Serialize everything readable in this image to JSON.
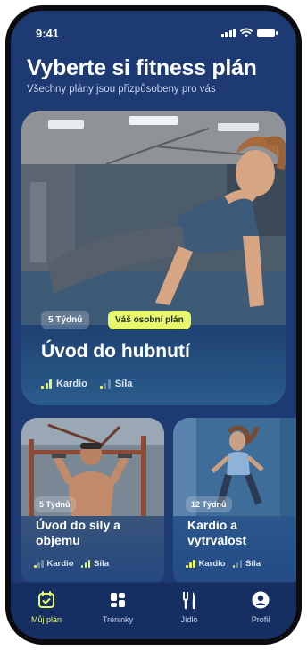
{
  "status_bar": {
    "time": "9:41"
  },
  "header": {
    "title": "Vyberte si fitness plán",
    "subtitle": "Všechny plány jsou přizpůsobeny pro vás"
  },
  "featured_plan": {
    "duration": "5 Týdnů",
    "badge": "Váš osobní plán",
    "name": "Úvod do hubnutí",
    "tags": [
      {
        "label": "Kardio",
        "level": 3,
        "max_level": 3
      },
      {
        "label": "Síla",
        "level": 1,
        "max_level": 3
      }
    ]
  },
  "plans": [
    {
      "duration": "5 Týdnů",
      "name_line1": "Úvod do síly a",
      "name_line2": "objemu",
      "tags": [
        {
          "label": "Kardio",
          "level": 1,
          "max_level": 3
        },
        {
          "label": "Síla",
          "level": 3,
          "max_level": 3
        }
      ]
    },
    {
      "duration": "12 Týdnů",
      "name_line1": "Kardio a",
      "name_line2": "vytrvalost",
      "tags": [
        {
          "label": "Kardio",
          "level": 3,
          "max_level": 3
        },
        {
          "label": "Síla",
          "level": 1,
          "max_level": 3
        }
      ]
    }
  ],
  "tab_bar": {
    "items": [
      {
        "label": "Můj plán",
        "icon": "calendar-check-icon",
        "active": true
      },
      {
        "label": "Tréninky",
        "icon": "grid-icon",
        "active": false
      },
      {
        "label": "Jídlo",
        "icon": "cutlery-icon",
        "active": false
      },
      {
        "label": "Profil",
        "icon": "profile-icon",
        "active": false
      }
    ]
  },
  "colors": {
    "background": "#1d3a73",
    "accent": "#e8f76c",
    "tab_bar": "#162f62"
  }
}
